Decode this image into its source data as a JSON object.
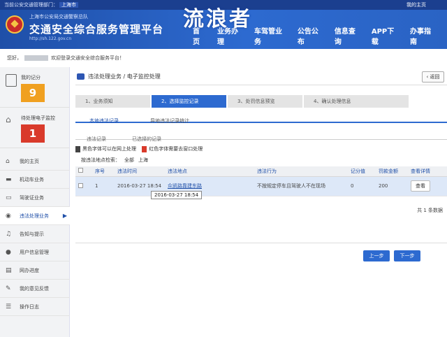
{
  "topbar": {
    "department_label": "当前公安交通管理部门：",
    "city": "上海市",
    "right_text": "我的主页"
  },
  "header": {
    "subtitle": "上海市公安局交通警察总队",
    "title": "交通安全综合服务管理平台",
    "url": "http://sh.122.gov.cn",
    "nav": [
      "首页",
      "业务办理",
      "车驾管业务",
      "公告公布",
      "信息查询",
      "APP下载",
      "办事指南"
    ],
    "overlay_title": "流浪者"
  },
  "welcome": {
    "prefix": "您好，",
    "suffix": "欢迎登录交通安全综合服务平台！"
  },
  "sidebar": {
    "score_label": "我的记分",
    "score_value": "9",
    "pending_label": "待处理电子监控",
    "pending_value": "1",
    "items": [
      {
        "icon": "home-icon",
        "label": "我的主页"
      },
      {
        "icon": "car-icon",
        "label": "机动车业务"
      },
      {
        "icon": "license-icon",
        "label": "驾驶证业务"
      },
      {
        "icon": "camera-icon",
        "label": "违法处理业务"
      },
      {
        "icon": "bell-icon",
        "label": "告知与提示"
      },
      {
        "icon": "user-icon",
        "label": "用户信息管理"
      },
      {
        "icon": "progress-icon",
        "label": "网办进度"
      },
      {
        "icon": "feedback-icon",
        "label": "我的意见反馈"
      },
      {
        "icon": "log-icon",
        "label": "操作日志"
      }
    ]
  },
  "breadcrumb": {
    "section": "违法处理业务",
    "sep": "/",
    "page": "电子监控处理",
    "back": "返回"
  },
  "steps": [
    "1、业务须知",
    "2、选择监控记录",
    "3、处罚信息预览",
    "4、确认处理信息"
  ],
  "tabs": [
    "本地违法记录",
    "异地违法记录统计"
  ],
  "subtabs": [
    "违法记录",
    "已选择的记录"
  ],
  "legend": {
    "black": "黑色字体可以在网上处理",
    "red": "红色字体需要去窗口处理"
  },
  "filter": {
    "label": "按违法地点检索：",
    "options": [
      "全部",
      "上海"
    ]
  },
  "table": {
    "headers": [
      "",
      "序号",
      "违法时间",
      "违法地点",
      "违法行为",
      "记分值",
      "罚款金额",
      "查看详情"
    ],
    "rows": [
      {
        "index": "1",
        "time": "2016-03-27 18:54",
        "location": "众凯路靠建东路",
        "behavior": "不按规定停车且驾驶人不在现场",
        "points": "0",
        "fine": "200",
        "action": "查看"
      }
    ]
  },
  "tooltip": "2016-03-27 18:54",
  "pagination": {
    "total": "共 1 条数据",
    "prev": "上一步",
    "next": "下一步"
  }
}
